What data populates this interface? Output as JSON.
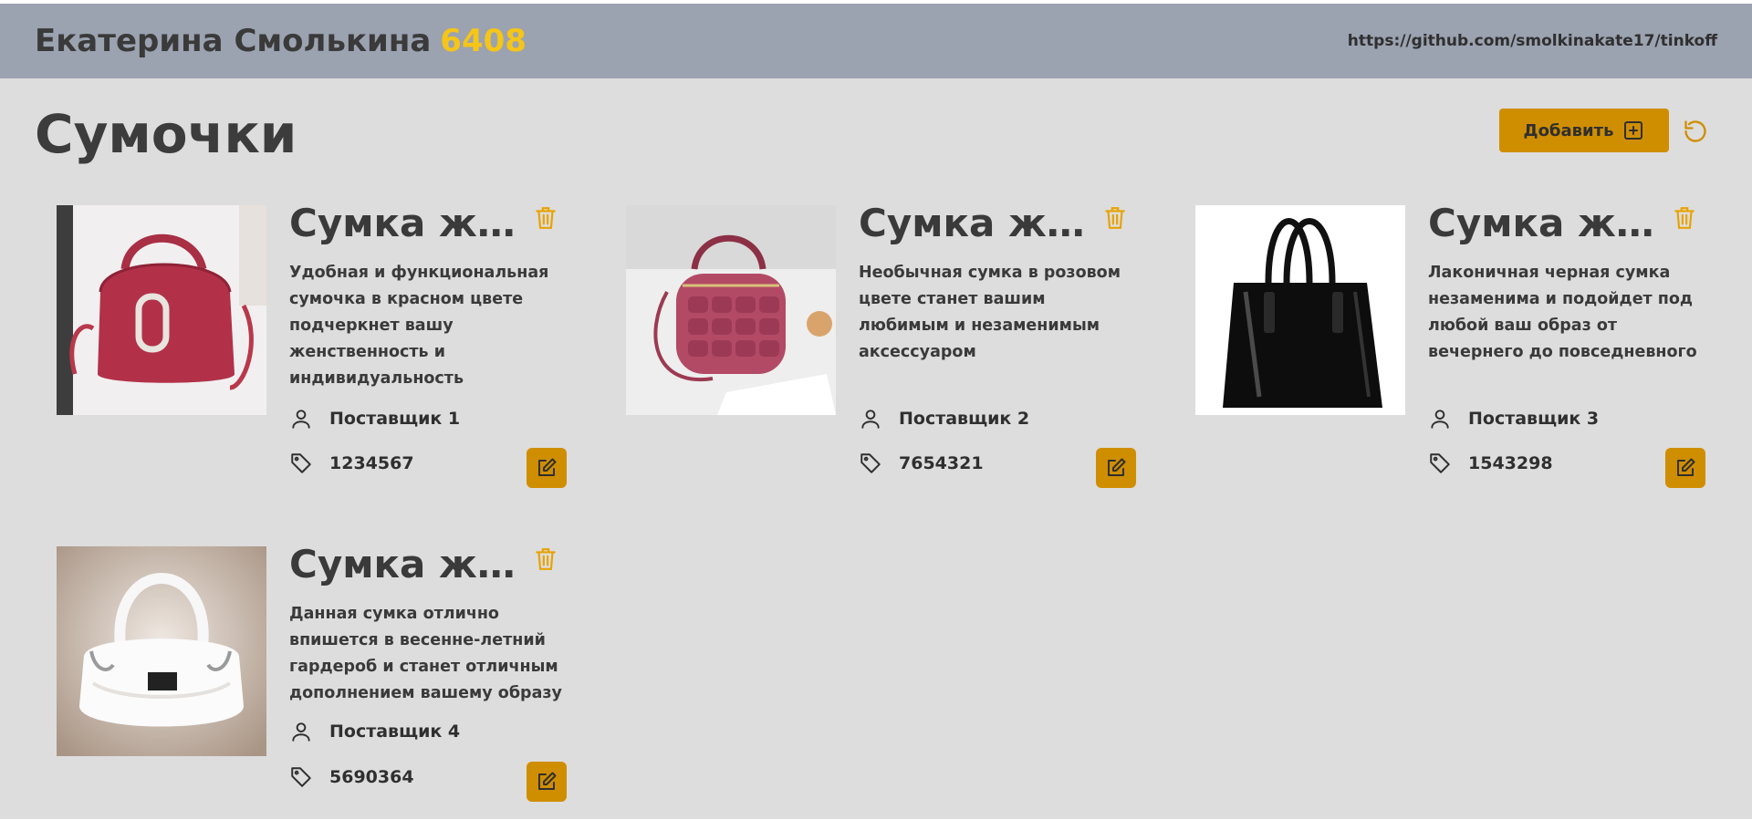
{
  "header": {
    "author": "Екатерина Смолькина",
    "variant": "6408",
    "repo_link": "https://github.com/smolkinakate17/tinkoff"
  },
  "page": {
    "title": "Сумочки",
    "add_label": "Добавить"
  },
  "colors": {
    "header_bg": "#9ba2b0",
    "page_bg": "#dddddd",
    "accent": "#cf8e00",
    "variant_text": "#f5c518"
  },
  "icons": [
    "plus-square-icon",
    "refresh-icon",
    "trash-icon",
    "user-icon",
    "tag-icon",
    "edit-icon"
  ],
  "products": [
    {
      "title": "Сумка же...",
      "description": "Удобная и функциональная сумочка в красном цвете подчеркнет вашу женственность и индивидуальность",
      "supplier": "Поставщик 1",
      "code": "1234567",
      "image": "red bag photo"
    },
    {
      "title": "Сумка же...",
      "description": "Необычная сумка в розовом цвете станет вашим любимым и незаменимым аксессуаром",
      "supplier": "Поставщик 2",
      "code": "7654321",
      "image": "pink quilted bag photo"
    },
    {
      "title": "Сумка же...",
      "description": "Лаконичная черная сумка незаменима и подойдет под любой ваш образ от вечернего до повседневного",
      "supplier": "Поставщик 3",
      "code": "1543298",
      "image": "black glossy bag photo"
    },
    {
      "title": "Сумка же...",
      "description": "Данная сумка отлично впишется в весенне-летний гардероб и станет отличным дополнением вашему образу",
      "supplier": "Поставщик 4",
      "code": "5690364",
      "image": "white bag photo"
    }
  ]
}
